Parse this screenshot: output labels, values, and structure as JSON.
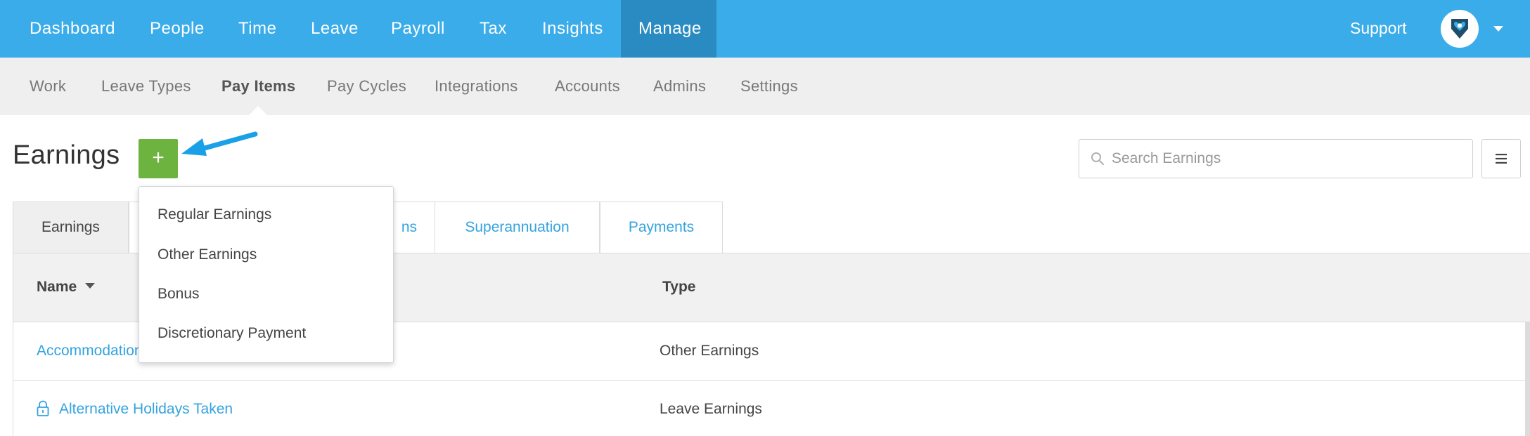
{
  "colors": {
    "top_nav_bg": "#3aace9",
    "top_nav_active_bg": "#2a8bc2",
    "sub_nav_bg": "#efefef",
    "add_button_bg": "#6db33f",
    "link_blue": "#33a3e0",
    "annotation_arrow": "#1aa0e6"
  },
  "top_nav": {
    "items": [
      {
        "label": "Dashboard"
      },
      {
        "label": "People"
      },
      {
        "label": "Time"
      },
      {
        "label": "Leave"
      },
      {
        "label": "Payroll"
      },
      {
        "label": "Tax"
      },
      {
        "label": "Insights"
      },
      {
        "label": "Manage",
        "active": true
      }
    ],
    "support_label": "Support",
    "avatar_icon": "heart-pin-logo-icon",
    "account_menu_icon": "caret-down-icon"
  },
  "sub_nav": {
    "items": [
      {
        "label": "Work"
      },
      {
        "label": "Leave Types"
      },
      {
        "label": "Pay Items",
        "active": true
      },
      {
        "label": "Pay Cycles"
      },
      {
        "label": "Integrations"
      },
      {
        "label": "Accounts"
      },
      {
        "label": "Admins"
      },
      {
        "label": "Settings"
      }
    ]
  },
  "page": {
    "title": "Earnings",
    "add_button_label": "+",
    "search_placeholder": "Search Earnings",
    "search_value": "",
    "menu_icon": "hamburger-icon"
  },
  "tabs": [
    {
      "label": "Earnings",
      "active": true
    },
    {
      "label": ""
    },
    {
      "label": "ns"
    },
    {
      "label": "Superannuation"
    },
    {
      "label": "Payments"
    }
  ],
  "table": {
    "columns": {
      "name": "Name",
      "type": "Type"
    },
    "rows": [
      {
        "name": "Accommodation",
        "type": "Other Earnings",
        "locked": false
      },
      {
        "name": "Alternative Holidays Taken",
        "type": "Leave Earnings",
        "locked": true
      }
    ]
  },
  "add_menu": {
    "items": [
      "Regular Earnings",
      "Other Earnings",
      "Bonus",
      "Discretionary Payment"
    ]
  }
}
